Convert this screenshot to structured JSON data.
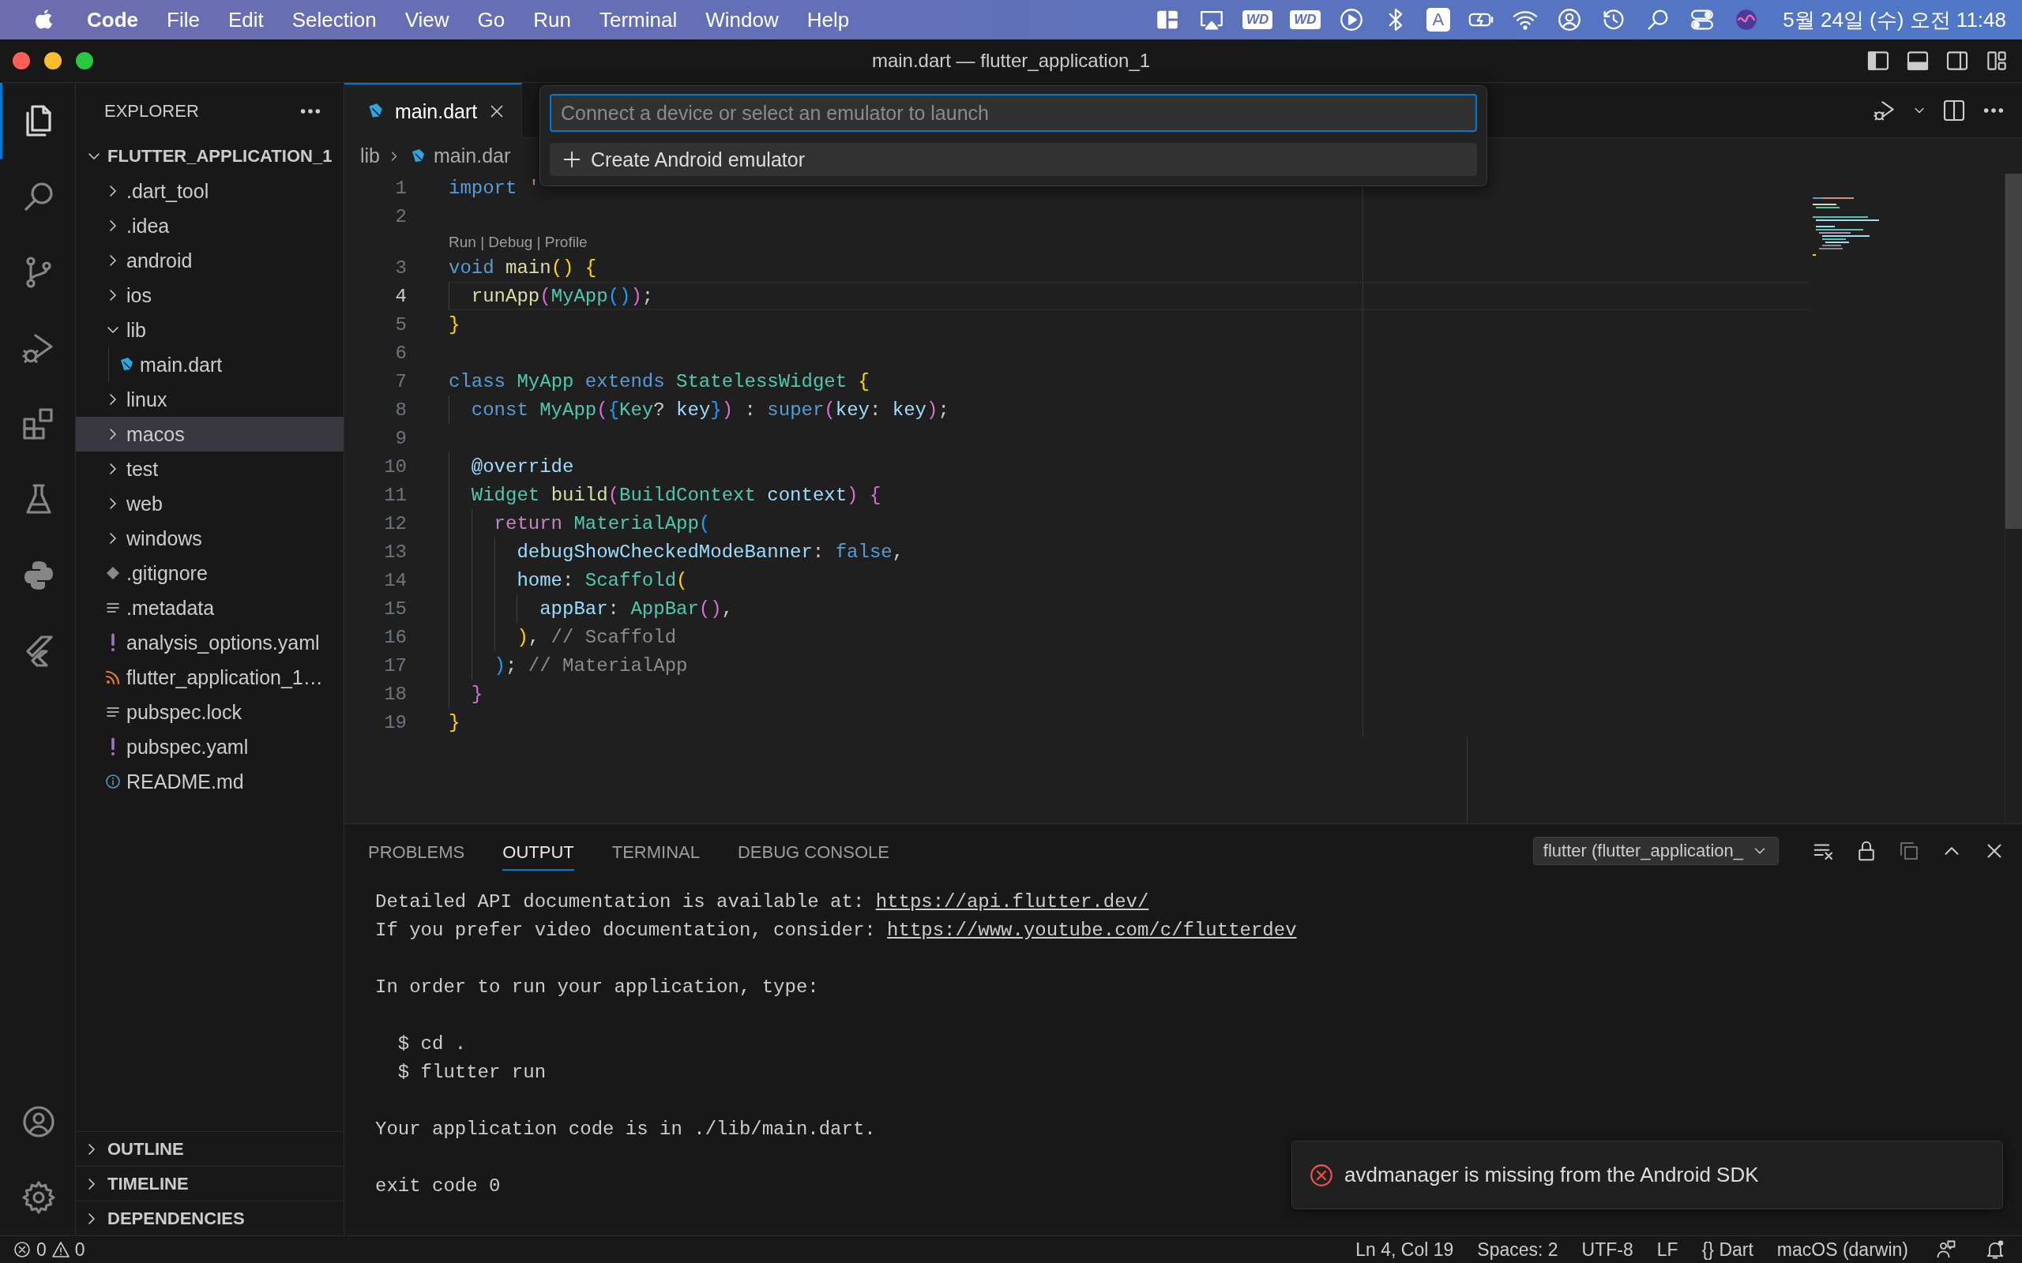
{
  "menu_bar": {
    "menus": [
      {
        "label": "Code",
        "kind": "app"
      },
      {
        "label": "File",
        "kind": "menu"
      },
      {
        "label": "Edit",
        "kind": "menu"
      },
      {
        "label": "Selection",
        "kind": "menu"
      },
      {
        "label": "View",
        "kind": "menu"
      },
      {
        "label": "Go",
        "kind": "menu"
      },
      {
        "label": "Run",
        "kind": "menu"
      },
      {
        "label": "Terminal",
        "kind": "menu"
      },
      {
        "label": "Window",
        "kind": "menu"
      },
      {
        "label": "Help",
        "kind": "menu"
      }
    ],
    "extras": [
      {
        "kind": "layout"
      },
      {
        "kind": "airplay"
      },
      {
        "kind": "drive",
        "text": "WD"
      },
      {
        "kind": "drive",
        "text": "WD"
      },
      {
        "kind": "play"
      },
      {
        "kind": "bluetooth"
      },
      {
        "kind": "input",
        "text": "A"
      },
      {
        "kind": "battery"
      },
      {
        "kind": "wifi"
      },
      {
        "kind": "user"
      },
      {
        "kind": "history"
      },
      {
        "kind": "search"
      },
      {
        "kind": "switches"
      },
      {
        "kind": "siri"
      }
    ],
    "clock": "5월 24일 (수) 오전 11:48"
  },
  "window": {
    "title": "main.dart — flutter_application_1"
  },
  "activity_bar": [
    {
      "kind": "files",
      "selected": true
    },
    {
      "kind": "search",
      "selected": false
    },
    {
      "kind": "branch",
      "selected": false
    },
    {
      "kind": "debug",
      "selected": false
    },
    {
      "kind": "extensions",
      "selected": false
    },
    {
      "kind": "flask",
      "selected": false
    },
    {
      "kind": "python",
      "selected": false
    },
    {
      "kind": "flutter",
      "selected": false
    },
    {
      "kind": "account",
      "selected": false
    },
    {
      "kind": "gear",
      "selected": false
    }
  ],
  "explorer": {
    "title": "EXPLORER",
    "folder": {
      "label": "FLUTTER_APPLICATION_1",
      "expanded": true
    },
    "items": [
      {
        "label": ".dart_tool",
        "kind": "folder",
        "expanded": false,
        "selected": false
      },
      {
        "label": ".idea",
        "kind": "folder",
        "expanded": false,
        "selected": false
      },
      {
        "label": "android",
        "kind": "folder",
        "expanded": false,
        "selected": false
      },
      {
        "label": "ios",
        "kind": "folder",
        "expanded": false,
        "selected": false
      },
      {
        "label": "lib",
        "kind": "folder",
        "expanded": true,
        "selected": false,
        "children": [
          {
            "label": "main.dart",
            "kind": "dart",
            "selected": false
          }
        ]
      },
      {
        "label": "linux",
        "kind": "folder",
        "expanded": false,
        "selected": false
      },
      {
        "label": "macos",
        "kind": "folder",
        "expanded": false,
        "selected": true
      },
      {
        "label": "test",
        "kind": "folder",
        "expanded": false,
        "selected": false
      },
      {
        "label": "web",
        "kind": "folder",
        "expanded": false,
        "selected": false
      },
      {
        "label": "windows",
        "kind": "folder",
        "expanded": false,
        "selected": false
      },
      {
        "label": ".gitignore",
        "kind": "git",
        "selected": false
      },
      {
        "label": ".metadata",
        "kind": "lines",
        "selected": false
      },
      {
        "label": "analysis_options.yaml",
        "kind": "yaml",
        "selected": false
      },
      {
        "label": "flutter_application_1…",
        "kind": "feed",
        "selected": false
      },
      {
        "label": "pubspec.lock",
        "kind": "lines",
        "selected": false
      },
      {
        "label": "pubspec.yaml",
        "kind": "yaml",
        "selected": false
      },
      {
        "label": "README.md",
        "kind": "info",
        "selected": false
      }
    ],
    "sections": [
      {
        "label": "OUTLINE",
        "expanded": false
      },
      {
        "label": "TIMELINE",
        "expanded": false
      },
      {
        "label": "DEPENDENCIES",
        "expanded": false
      }
    ]
  },
  "editor": {
    "tabs": [
      {
        "label": "main.dart",
        "selected": true
      }
    ],
    "breadcrumb": [
      "lib",
      "main.dar"
    ],
    "lines": [
      {
        "kind": "code",
        "number": "1",
        "current": false,
        "tokens": [
          {
            "t": "import",
            "kind": "kw"
          },
          {
            "t": " '",
            "kind": "str"
          }
        ]
      },
      {
        "kind": "code",
        "number": "2",
        "current": false
      },
      {
        "kind": "codelens",
        "text": "Run | Debug | Profile"
      },
      {
        "kind": "code",
        "number": "3",
        "current": false,
        "tokens": [
          {
            "t": "void ",
            "kind": "kw"
          },
          {
            "t": "main",
            "kind": "fn"
          },
          {
            "t": "() ",
            "kind": "b1"
          },
          {
            "t": "{",
            "kind": "b1"
          }
        ]
      },
      {
        "kind": "code",
        "number": "4",
        "current": true,
        "tokens": [
          {
            "t": "  runApp",
            "kind": "fn"
          },
          {
            "t": "(",
            "kind": "b2"
          },
          {
            "t": "MyApp",
            "kind": "type"
          },
          {
            "t": "()",
            "kind": "b3"
          },
          {
            "t": ")",
            "kind": "b2"
          },
          {
            "t": ";",
            "kind": "punc"
          }
        ]
      },
      {
        "kind": "code",
        "number": "5",
        "current": false,
        "tokens": [
          {
            "t": "}",
            "kind": "b1"
          }
        ]
      },
      {
        "kind": "code",
        "number": "6",
        "current": false
      },
      {
        "kind": "code",
        "number": "7",
        "current": false,
        "tokens": [
          {
            "t": "class ",
            "kind": "kw"
          },
          {
            "t": "MyApp ",
            "kind": "type"
          },
          {
            "t": "extends ",
            "kind": "kw"
          },
          {
            "t": "StatelessWidget ",
            "kind": "type"
          },
          {
            "t": "{",
            "kind": "b1"
          }
        ]
      },
      {
        "kind": "code",
        "number": "8",
        "current": false,
        "tokens": [
          {
            "t": "  const ",
            "kind": "kw"
          },
          {
            "t": "MyApp",
            "kind": "type"
          },
          {
            "t": "(",
            "kind": "b2"
          },
          {
            "t": "{",
            "kind": "b3"
          },
          {
            "t": "Key",
            "kind": "type"
          },
          {
            "t": "? ",
            "kind": "punc"
          },
          {
            "t": "key",
            "kind": "var"
          },
          {
            "t": "}",
            "kind": "b3"
          },
          {
            "t": ")",
            "kind": "b2"
          },
          {
            "t": " : ",
            "kind": "punc"
          },
          {
            "t": "super",
            "kind": "kw"
          },
          {
            "t": "(",
            "kind": "b2"
          },
          {
            "t": "key",
            "kind": "var"
          },
          {
            "t": ": ",
            "kind": "punc"
          },
          {
            "t": "key",
            "kind": "var"
          },
          {
            "t": ")",
            "kind": "b2"
          },
          {
            "t": ";",
            "kind": "punc"
          }
        ]
      },
      {
        "kind": "code",
        "number": "9",
        "current": false
      },
      {
        "kind": "code",
        "number": "10",
        "current": false,
        "tokens": [
          {
            "t": "  @override",
            "kind": "var"
          }
        ]
      },
      {
        "kind": "code",
        "number": "11",
        "current": false,
        "tokens": [
          {
            "t": "  Widget ",
            "kind": "type"
          },
          {
            "t": "build",
            "kind": "fn"
          },
          {
            "t": "(",
            "kind": "b2"
          },
          {
            "t": "BuildContext ",
            "kind": "type"
          },
          {
            "t": "context",
            "kind": "var"
          },
          {
            "t": ") {",
            "kind": "b2"
          }
        ]
      },
      {
        "kind": "code",
        "number": "12",
        "current": false,
        "tokens": [
          {
            "t": "    return ",
            "kind": "ctrl"
          },
          {
            "t": "MaterialApp",
            "kind": "type"
          },
          {
            "t": "(",
            "kind": "b3"
          }
        ]
      },
      {
        "kind": "code",
        "number": "13",
        "current": false,
        "tokens": [
          {
            "t": "      debugShowCheckedModeBanner",
            "kind": "var"
          },
          {
            "t": ": ",
            "kind": "punc"
          },
          {
            "t": "false",
            "kind": "kw"
          },
          {
            "t": ",",
            "kind": "punc"
          }
        ]
      },
      {
        "kind": "code",
        "number": "14",
        "current": false,
        "tokens": [
          {
            "t": "      home",
            "kind": "var"
          },
          {
            "t": ": ",
            "kind": "punc"
          },
          {
            "t": "Scaffold",
            "kind": "type"
          },
          {
            "t": "(",
            "kind": "b1"
          }
        ]
      },
      {
        "kind": "code",
        "number": "15",
        "current": false,
        "tokens": [
          {
            "t": "        appBar",
            "kind": "var"
          },
          {
            "t": ": ",
            "kind": "punc"
          },
          {
            "t": "AppBar",
            "kind": "type"
          },
          {
            "t": "()",
            "kind": "b2"
          },
          {
            "t": ",",
            "kind": "punc"
          }
        ]
      },
      {
        "kind": "code",
        "number": "16",
        "current": false,
        "tokens": [
          {
            "t": "      )",
            "kind": "b1"
          },
          {
            "t": ", ",
            "kind": "punc"
          },
          {
            "t": "// Scaffold",
            "kind": "cm"
          }
        ]
      },
      {
        "kind": "code",
        "number": "17",
        "current": false,
        "tokens": [
          {
            "t": "    )",
            "kind": "b3"
          },
          {
            "t": "; ",
            "kind": "punc"
          },
          {
            "t": "// MaterialApp",
            "kind": "cm"
          }
        ]
      },
      {
        "kind": "code",
        "number": "18",
        "current": false,
        "tokens": [
          {
            "t": "  }",
            "kind": "b2"
          }
        ]
      },
      {
        "kind": "code",
        "number": "19",
        "current": false,
        "tokens": [
          {
            "t": "}",
            "kind": "b1"
          }
        ]
      }
    ]
  },
  "quick_pick": {
    "placeholder": "Connect a device or select an emulator to launch",
    "items": [
      {
        "label": "Create Android emulator",
        "selected": true
      }
    ]
  },
  "panel": {
    "tabs": [
      {
        "label": "PROBLEMS",
        "selected": false
      },
      {
        "label": "OUTPUT",
        "selected": true
      },
      {
        "label": "TERMINAL",
        "selected": false
      },
      {
        "label": "DEBUG CONSOLE",
        "selected": false
      }
    ],
    "channel": "flutter (flutter_application_",
    "lines": [
      {
        "kind": "text",
        "text": "Detailed API documentation is available at:",
        "link": "https://api.flutter.dev/"
      },
      {
        "kind": "text",
        "text": "If you prefer video documentation, consider:",
        "link": "https://www.youtube.com/c/flutterdev"
      },
      {
        "kind": "blank"
      },
      {
        "kind": "text",
        "text": "In order to run your application, type:"
      },
      {
        "kind": "blank"
      },
      {
        "kind": "text",
        "text": "  $ cd ."
      },
      {
        "kind": "text",
        "text": "  $ flutter run"
      },
      {
        "kind": "blank"
      },
      {
        "kind": "text",
        "text": "Your application code is in ./lib/main.dart."
      },
      {
        "kind": "blank"
      },
      {
        "kind": "text",
        "text": "exit code 0"
      }
    ]
  },
  "notification": {
    "kind": "error",
    "message": "avdmanager is missing from the Android SDK"
  },
  "status_bar": {
    "errors": "0",
    "warnings": "0",
    "items": [
      {
        "text": "Ln 4, Col 19"
      },
      {
        "text": "Spaces: 2"
      },
      {
        "text": "UTF-8"
      },
      {
        "text": "LF"
      },
      {
        "icon": "{}",
        "text": "Dart"
      },
      {
        "text": "macOS (darwin)"
      }
    ]
  }
}
